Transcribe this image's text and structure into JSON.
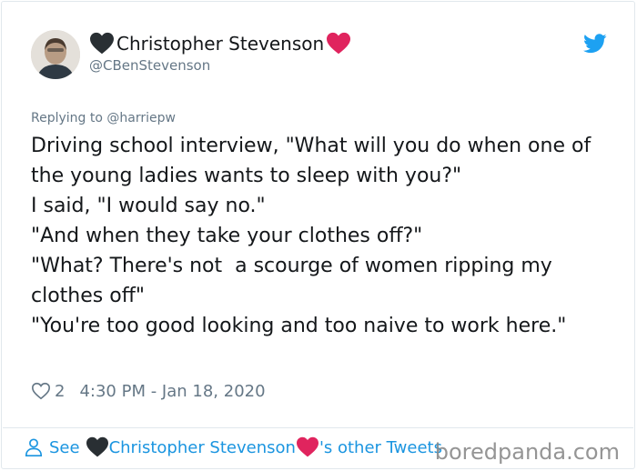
{
  "tweet": {
    "display_name": "Christopher Stevenson",
    "handle": "@CBenStevenson",
    "reply_to": "Replying to @harriepw",
    "text": "Driving school interview, \"What will you do when one of the young ladies wants to sleep with you?\"\nI said, \"I would say no.\"\n\"And when they take your clothes off?\"\n\"What? There's not  a scourge of women ripping my clothes off\"\n\"You're too good looking and too naive to work here.\"",
    "like_count": "2",
    "timestamp": "4:30 PM - Jan 18, 2020"
  },
  "footer": {
    "see_label": "See",
    "name": "Christopher Stevenson",
    "suffix": "'s other Tweets"
  },
  "watermark": "boredpanda.com",
  "icons": {
    "black_heart": "black-heart-icon",
    "red_heart": "red-heart-icon",
    "twitter": "twitter-bird-icon",
    "like": "heart-outline-icon",
    "person": "person-icon"
  },
  "colors": {
    "accent": "#1b95e0",
    "twitter_blue": "#1da1f2",
    "secondary_text": "#657786",
    "red_heart": "#e0245e",
    "black_heart": "#292f33"
  }
}
